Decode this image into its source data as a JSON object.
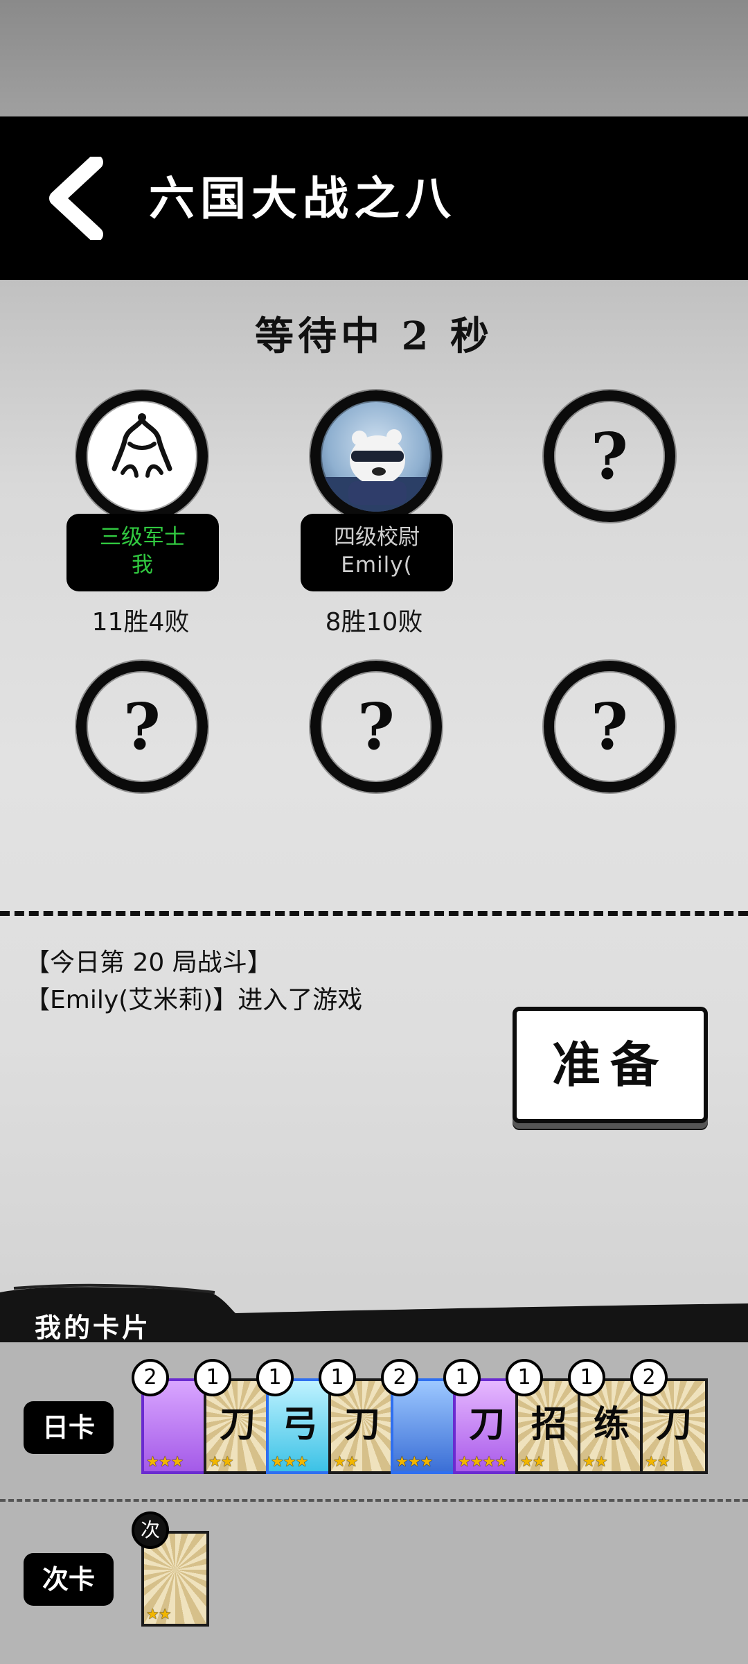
{
  "header": {
    "title": "六国大战之八"
  },
  "status": {
    "waiting_text": "等待中 2 秒"
  },
  "players": [
    {
      "rank": "三级军士",
      "name": "我",
      "record": "11胜4败"
    },
    {
      "rank": "四级校尉",
      "name": "Emily(",
      "record": "8胜10败"
    }
  ],
  "empty_slot_label": "?",
  "log": {
    "lines": [
      "【今日第 20 局战斗】",
      "【Emily(艾米莉)】进入了游戏"
    ]
  },
  "ready_button": {
    "label": "准备"
  },
  "cards": {
    "section_label": "我的卡片",
    "day_label": "日卡",
    "next_label": "次卡",
    "day_cards": [
      {
        "count": "2",
        "glyph": "",
        "stars": 3,
        "bg": "purple"
      },
      {
        "count": "1",
        "glyph": "刀",
        "stars": 2,
        "bg": "tan"
      },
      {
        "count": "1",
        "glyph": "弓",
        "stars": 3,
        "bg": "cyan"
      },
      {
        "count": "1",
        "glyph": "刀",
        "stars": 2,
        "bg": "tan"
      },
      {
        "count": "2",
        "glyph": "",
        "stars": 3,
        "bg": "blue"
      },
      {
        "count": "1",
        "glyph": "刀",
        "stars": 4,
        "bg": "violet"
      },
      {
        "count": "1",
        "glyph": "招",
        "stars": 2,
        "bg": "tan"
      },
      {
        "count": "1",
        "glyph": "练",
        "stars": 2,
        "bg": "tan"
      },
      {
        "count": "2",
        "glyph": "刀",
        "stars": 2,
        "bg": "tan"
      }
    ],
    "next_cards": [
      {
        "count": "次",
        "glyph": "",
        "stars": 2,
        "bg": "tan"
      }
    ]
  },
  "colors": {
    "rank_me": "#31c940",
    "rank_other": "#cfcfcf",
    "header_bg": "#000000"
  }
}
